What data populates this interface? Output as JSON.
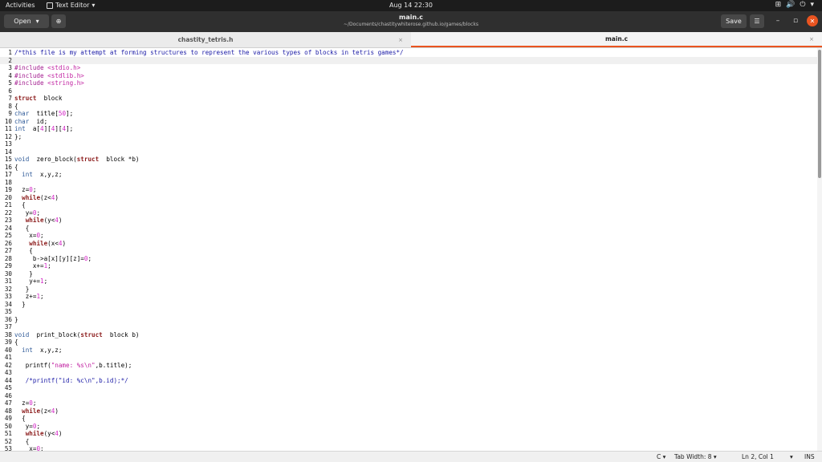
{
  "topbar": {
    "activities": "Activities",
    "app_name": "Text Editor",
    "app_arrow": "▾",
    "clock": "Aug 14  22:30",
    "sys_network": "⊞",
    "sys_volume": "🔊",
    "sys_power": "⏻",
    "sys_arrow": "▾"
  },
  "header": {
    "open_label": "Open",
    "open_arrow": "▾",
    "newtab_icon": "⊕",
    "title": "main.c",
    "subtitle": "~/Documents/chastitywhiterose.github.io/games/blocks",
    "save_label": "Save",
    "menu_icon": "☰",
    "minimize": "–",
    "maximize": "▫",
    "close": "✕"
  },
  "tabs": [
    {
      "label": "chastity_tetris.h",
      "close": "×"
    },
    {
      "label": "main.c",
      "close": "×"
    }
  ],
  "editor": {
    "current_line": 2,
    "lines": [
      {
        "n": "1",
        "s": [
          [
            "cm",
            "/*this file is my attempt at forming structures to represent the various types of blocks in tetris games*/"
          ]
        ]
      },
      {
        "n": "2",
        "s": []
      },
      {
        "n": "3",
        "s": [
          [
            "pp",
            "#include "
          ],
          [
            "str",
            "<stdio.h>"
          ]
        ]
      },
      {
        "n": "4",
        "s": [
          [
            "pp",
            "#include "
          ],
          [
            "str",
            "<stdlib.h>"
          ]
        ]
      },
      {
        "n": "5",
        "s": [
          [
            "pp",
            "#include "
          ],
          [
            "str",
            "<string.h>"
          ]
        ]
      },
      {
        "n": "6",
        "s": []
      },
      {
        "n": "7",
        "s": [
          [
            "kw",
            "struct"
          ],
          [
            "",
            "  block"
          ]
        ]
      },
      {
        "n": "8",
        "s": [
          [
            "",
            "{"
          ]
        ]
      },
      {
        "n": "9",
        "s": [
          [
            "ty",
            "char"
          ],
          [
            "",
            "  title["
          ],
          [
            "num",
            "50"
          ],
          [
            "",
            "];"
          ]
        ]
      },
      {
        "n": "10",
        "s": [
          [
            "ty",
            "char"
          ],
          [
            "",
            "  id;"
          ]
        ]
      },
      {
        "n": "11",
        "s": [
          [
            "ty",
            "int"
          ],
          [
            "",
            "  a["
          ],
          [
            "num",
            "4"
          ],
          [
            "",
            "]["
          ],
          [
            "num",
            "4"
          ],
          [
            "",
            "]["
          ],
          [
            "num",
            "4"
          ],
          [
            "",
            "];"
          ]
        ]
      },
      {
        "n": "12",
        "s": [
          [
            "",
            "};"
          ]
        ]
      },
      {
        "n": "13",
        "s": []
      },
      {
        "n": "14",
        "s": []
      },
      {
        "n": "15",
        "s": [
          [
            "ty",
            "void"
          ],
          [
            "",
            "  zero_block("
          ],
          [
            "kw",
            "struct"
          ],
          [
            "",
            "  block *b)"
          ]
        ]
      },
      {
        "n": "16",
        "s": [
          [
            "",
            "{"
          ]
        ]
      },
      {
        "n": "17",
        "s": [
          [
            "",
            "  "
          ],
          [
            "ty",
            "int"
          ],
          [
            "",
            "  x,y,z;"
          ]
        ]
      },
      {
        "n": "18",
        "s": []
      },
      {
        "n": "19",
        "s": [
          [
            "",
            "  z="
          ],
          [
            "num",
            "0"
          ],
          [
            "",
            ";"
          ]
        ]
      },
      {
        "n": "20",
        "s": [
          [
            "",
            "  "
          ],
          [
            "kw",
            "while"
          ],
          [
            "",
            "(z<"
          ],
          [
            "num",
            "4"
          ],
          [
            "",
            ")"
          ]
        ]
      },
      {
        "n": "21",
        "s": [
          [
            "",
            "  {"
          ]
        ]
      },
      {
        "n": "22",
        "s": [
          [
            "",
            "   y="
          ],
          [
            "num",
            "0"
          ],
          [
            "",
            ";"
          ]
        ]
      },
      {
        "n": "23",
        "s": [
          [
            "",
            "   "
          ],
          [
            "kw",
            "while"
          ],
          [
            "",
            "(y<"
          ],
          [
            "num",
            "4"
          ],
          [
            "",
            ")"
          ]
        ]
      },
      {
        "n": "24",
        "s": [
          [
            "",
            "   {"
          ]
        ]
      },
      {
        "n": "25",
        "s": [
          [
            "",
            "    x="
          ],
          [
            "num",
            "0"
          ],
          [
            "",
            ";"
          ]
        ]
      },
      {
        "n": "26",
        "s": [
          [
            "",
            "    "
          ],
          [
            "kw",
            "while"
          ],
          [
            "",
            "(x<"
          ],
          [
            "num",
            "4"
          ],
          [
            "",
            ")"
          ]
        ]
      },
      {
        "n": "27",
        "s": [
          [
            "",
            "    {"
          ]
        ]
      },
      {
        "n": "28",
        "s": [
          [
            "",
            "     b->a[x][y][z]="
          ],
          [
            "num",
            "0"
          ],
          [
            "",
            ";"
          ]
        ]
      },
      {
        "n": "29",
        "s": [
          [
            "",
            "     x+="
          ],
          [
            "num",
            "1"
          ],
          [
            "",
            ";"
          ]
        ]
      },
      {
        "n": "30",
        "s": [
          [
            "",
            "    }"
          ]
        ]
      },
      {
        "n": "31",
        "s": [
          [
            "",
            "    y+="
          ],
          [
            "num",
            "1"
          ],
          [
            "",
            ";"
          ]
        ]
      },
      {
        "n": "32",
        "s": [
          [
            "",
            "   }"
          ]
        ]
      },
      {
        "n": "33",
        "s": [
          [
            "",
            "   z+="
          ],
          [
            "num",
            "1"
          ],
          [
            "",
            ";"
          ]
        ]
      },
      {
        "n": "34",
        "s": [
          [
            "",
            "  }"
          ]
        ]
      },
      {
        "n": "35",
        "s": []
      },
      {
        "n": "36",
        "s": [
          [
            "",
            "}"
          ]
        ]
      },
      {
        "n": "37",
        "s": []
      },
      {
        "n": "38",
        "s": [
          [
            "ty",
            "void"
          ],
          [
            "",
            "  print_block("
          ],
          [
            "kw",
            "struct"
          ],
          [
            "",
            "  block b)"
          ]
        ]
      },
      {
        "n": "39",
        "s": [
          [
            "",
            "{"
          ]
        ]
      },
      {
        "n": "40",
        "s": [
          [
            "",
            "  "
          ],
          [
            "ty",
            "int"
          ],
          [
            "",
            "  x,y,z;"
          ]
        ]
      },
      {
        "n": "41",
        "s": []
      },
      {
        "n": "42",
        "s": [
          [
            "",
            "   printf("
          ],
          [
            "str",
            "\"name: %s\\n\""
          ],
          [
            "",
            ",b.title);"
          ]
        ]
      },
      {
        "n": "43",
        "s": []
      },
      {
        "n": "44",
        "s": [
          [
            "",
            "   "
          ],
          [
            "cm",
            "/*printf(\"id: %c\\n\",b.id);*/"
          ]
        ]
      },
      {
        "n": "45",
        "s": []
      },
      {
        "n": "46",
        "s": []
      },
      {
        "n": "47",
        "s": [
          [
            "",
            "  z="
          ],
          [
            "num",
            "0"
          ],
          [
            "",
            ";"
          ]
        ]
      },
      {
        "n": "48",
        "s": [
          [
            "",
            "  "
          ],
          [
            "kw",
            "while"
          ],
          [
            "",
            "(z<"
          ],
          [
            "num",
            "4"
          ],
          [
            "",
            ")"
          ]
        ]
      },
      {
        "n": "49",
        "s": [
          [
            "",
            "  {"
          ]
        ]
      },
      {
        "n": "50",
        "s": [
          [
            "",
            "   y="
          ],
          [
            "num",
            "0"
          ],
          [
            "",
            ";"
          ]
        ]
      },
      {
        "n": "51",
        "s": [
          [
            "",
            "   "
          ],
          [
            "kw",
            "while"
          ],
          [
            "",
            "(y<"
          ],
          [
            "num",
            "4"
          ],
          [
            "",
            ")"
          ]
        ]
      },
      {
        "n": "52",
        "s": [
          [
            "",
            "   {"
          ]
        ]
      },
      {
        "n": "53",
        "s": [
          [
            "",
            "    x="
          ],
          [
            "num",
            "0"
          ],
          [
            "",
            ";"
          ]
        ]
      }
    ]
  },
  "status": {
    "language": "C ▾",
    "tab_width": "Tab Width: 8 ▾",
    "position": "Ln 2, Col 1",
    "position_arrow": "▾",
    "mode": "INS"
  }
}
